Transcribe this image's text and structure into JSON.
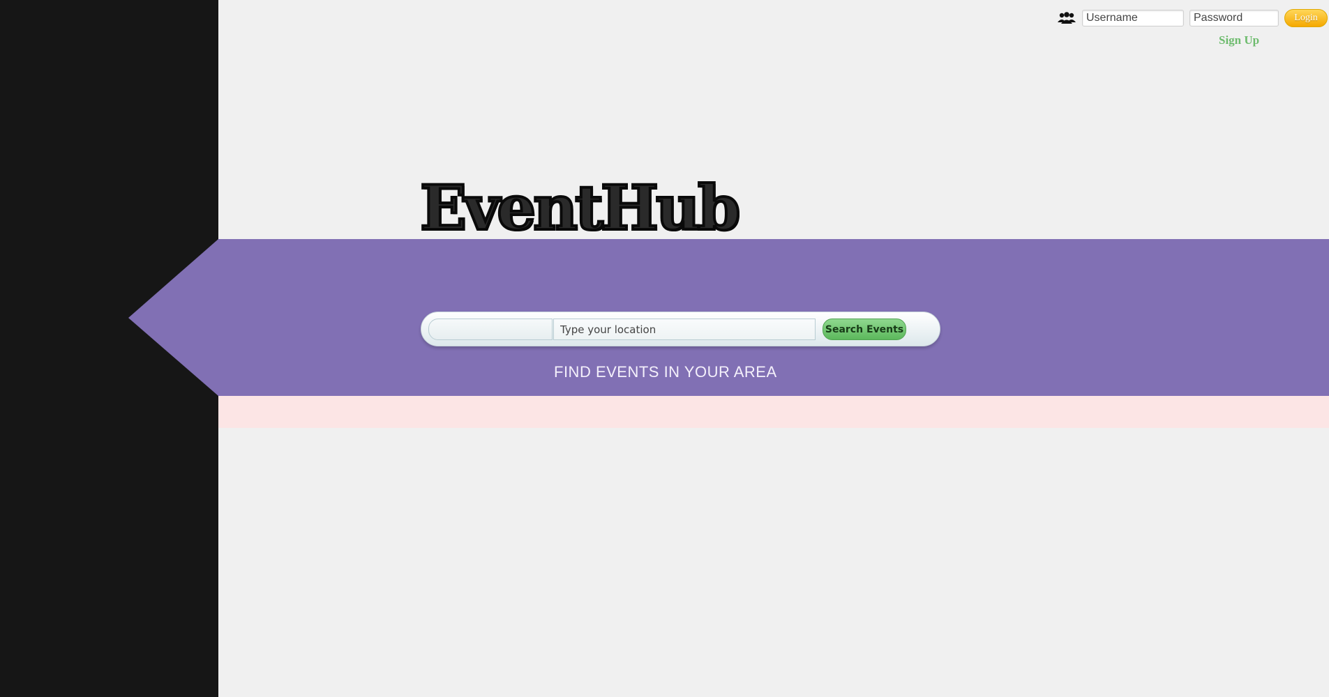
{
  "header": {
    "username_placeholder": "Username",
    "password_placeholder": "Password",
    "login_label": "Login",
    "signup_label": "Sign Up",
    "users_icon": "users-icon"
  },
  "hero": {
    "brand": "EventHub",
    "keyword_value": "",
    "location_placeholder": "Type your location",
    "search_label": "Search Events",
    "tagline": "FIND EVENTS IN YOUR AREA"
  },
  "colors": {
    "sidebar": "#161616",
    "band": "#8170b4",
    "strip": "#fce5e5",
    "login_button": "#f5a800",
    "search_button": "#5cb85c",
    "signup_link": "#6dbb6d"
  }
}
